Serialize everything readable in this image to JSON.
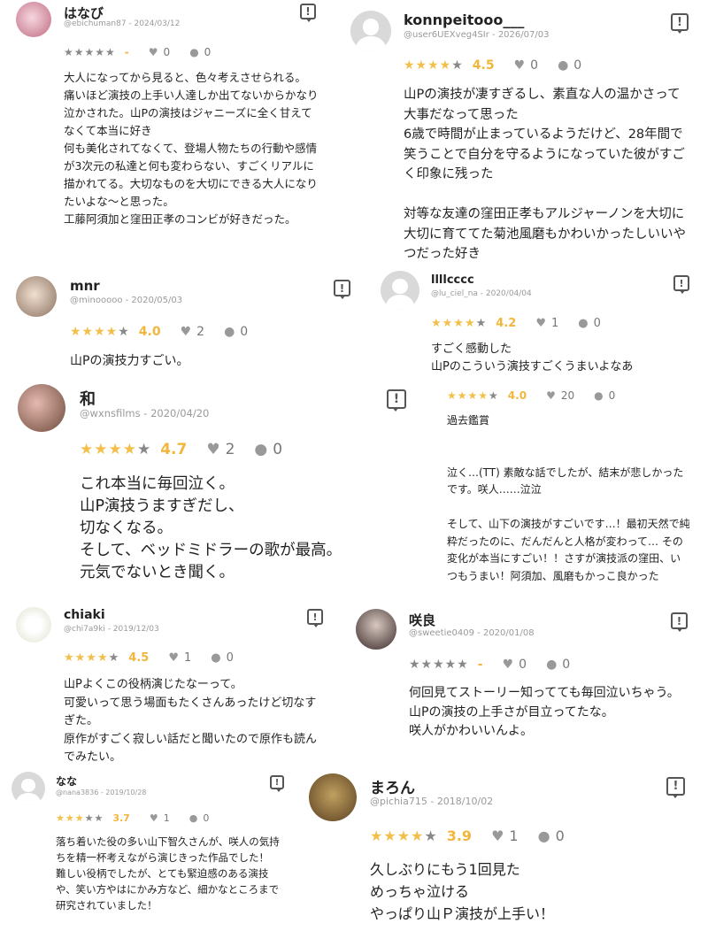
{
  "reviews": [
    {
      "name": "はなび",
      "id": "@ebichuman87 - 2024/03/12",
      "stars": "",
      "score": "-",
      "likes": "0",
      "comments": "0",
      "body": "大人になってから見ると、色々考えさせられる。\n痛いほど演技の上手い人達しか出てないからかなり泣かされた。山Pの演技はジャニーズに全く甘えてなくて本当に好き\n何も美化されてなくて、登場人物たちの行動や感情が3次元の私達と何も変わらない、すごくリアルに描かれてる。大切なものを大切にできる大人になりたいよな〜と思った。\n工藤阿須加と窪田正孝のコンビが好きだった。"
    },
    {
      "name": "konnpeitooo___",
      "id": "@user6UEXveg4SIr - 2026/07/03",
      "stars": "4.5",
      "score": "4.5",
      "likes": "0",
      "comments": "0",
      "body": "山Pの演技が凄すぎるし、素直な人の温かさって大事だなって思った\n6歳で時間が止まっているようだけど、28年間で笑うことで自分を守るようになっていた彼がすごく印象に残った\n\n対等な友達の窪田正孝もアルジャーノンを大切に大切に育ててた菊池風磨もかわいかったしいいやつだった好き"
    },
    {
      "name": "mnr",
      "id": "@minooooo - 2020/05/03",
      "stars": "4.0",
      "score": "4.0",
      "likes": "2",
      "comments": "0",
      "body": "山Pの演技力すごい。"
    },
    {
      "name": "llllcccc",
      "id": "@lu_ciel_na - 2020/04/04",
      "stars": "4.2",
      "score": "4.2",
      "likes": "1",
      "comments": "0",
      "body": "すごく感動した\n山Pのこういう演技すごくうまいよなあ"
    },
    {
      "name": "和",
      "id": "@wxnsfilms - 2020/04/20",
      "stars": "4.7",
      "score": "4.7",
      "likes": "2",
      "comments": "0",
      "body": "これ本当に毎回泣く。\n山P演技うますぎだし、\n切なくなる。\nそして、ベッドミドラーの歌が最高。\n元気でないとき聞く。"
    },
    {
      "name": "",
      "id": "",
      "stars": "4.0",
      "score": "4.0",
      "likes": "20",
      "comments": "0",
      "body": "過去鑑賞\n\n\n泣く…(TT) 素敵な話でしたが、結末が悲しかったです。咲人……泣泣\n\nそして、山下の演技がすごいです…！最初天然で純粋だったのに、だんだんと人格が変わって… その変化が本当にすごい！！さすが演技派の窪田、いつもうまい！阿須加、風磨もかっこ良かった"
    },
    {
      "name": "chiaki",
      "id": "@chi7a9ki - 2019/12/03",
      "stars": "4.5",
      "score": "4.5",
      "likes": "1",
      "comments": "0",
      "body": "山Pよくこの役柄演じたなーって。\n可愛いって思う場面もたくさんあったけど切なすぎた。\n原作がすごく寂しい話だと聞いたので原作も読んでみたい。"
    },
    {
      "name": "咲良",
      "id": "@sweetie0409 - 2020/01/08",
      "stars": "",
      "score": "-",
      "likes": "0",
      "comments": "0",
      "body": "何回見てストーリー知ってても毎回泣いちゃう。\n山Pの演技の上手さが目立ってたな。\n咲人がかわいいんよ。"
    },
    {
      "name": "なな",
      "id": "@nana3836 - 2019/10/28",
      "stars": "3.7",
      "score": "3.7",
      "likes": "1",
      "comments": "0",
      "body": "落ち着いた役の多い山下智久さんが、咲人の気持ちを精一杯考えながら演じきった作品でした！\n難しい役柄でしたが、とても緊迫感のある演技や、笑い方やはにかみ方など、細かなところまで研究されていました！"
    },
    {
      "name": "まろん",
      "id": "@pichia715 - 2018/10/02",
      "stars": "3.9",
      "score": "3.9",
      "likes": "1",
      "comments": "0",
      "body": "久しぶりにもう1回見た\nめっちゃ泣ける\nやっぱり山Ｐ演技が上手い！"
    }
  ],
  "icons": {
    "report": "report-icon",
    "like": "heart-icon",
    "comment": "comment-icon"
  },
  "colors": {
    "star": "#f2c04a",
    "score": "#f2b63c",
    "muted": "#9a9a9a"
  }
}
